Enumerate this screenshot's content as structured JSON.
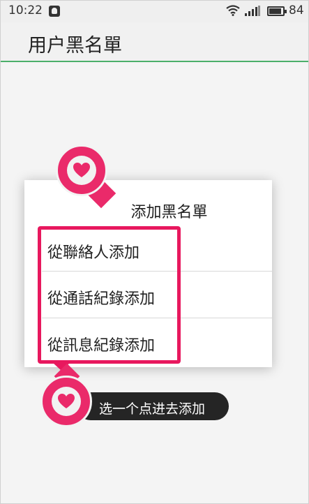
{
  "status_bar": {
    "time": "10:22",
    "battery": "84"
  },
  "action_bar": {
    "title": "用户黑名單"
  },
  "dialog": {
    "title": "添加黑名單",
    "items": [
      {
        "label": "從聯絡人添加"
      },
      {
        "label": "從通話紀錄添加"
      },
      {
        "label": "從訊息紀錄添加"
      }
    ]
  },
  "annotation": {
    "tooltip": "选一个点进去添加",
    "accent_color": "#e8185e",
    "marker_icon": "heart-icon"
  }
}
